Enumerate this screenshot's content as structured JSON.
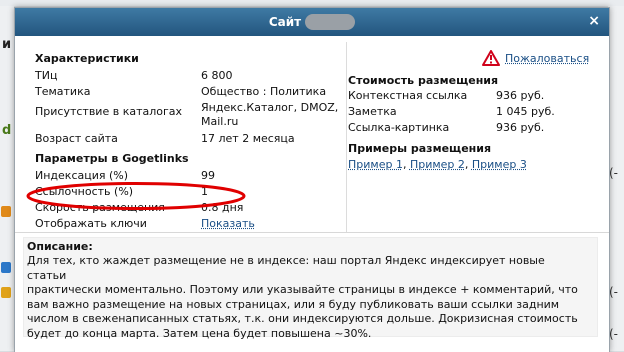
{
  "title": {
    "text": "Сайт"
  },
  "report_link": "Пожаловаться",
  "characteristics": {
    "heading": "Характеристики",
    "rows": [
      {
        "label": "ТИц",
        "value": "6 800"
      },
      {
        "label": "Тематика",
        "value": "Общество : Политика"
      },
      {
        "label": "Присутствие в каталогах",
        "value_lines": [
          "Яндекс.Каталог, DMOZ,",
          "Mail.ru"
        ]
      },
      {
        "label": "Возраст сайта",
        "value": "17 лет 2 месяца"
      }
    ]
  },
  "gogetlinks": {
    "heading": "Параметры в Gogetlinks",
    "rows": [
      {
        "label": "Индексация (%)",
        "value": "99"
      },
      {
        "label": "Ссылочность (%)",
        "value": "1"
      },
      {
        "label": "Скорость размещения",
        "value": "0.8 дня"
      },
      {
        "label": "Отображать ключи",
        "value": "Показать"
      }
    ]
  },
  "pricing": {
    "heading": "Стоимость размещения",
    "rows": [
      {
        "label": "Контекстная ссылка",
        "value": "936 руб."
      },
      {
        "label": "Заметка",
        "value": "1 045 руб."
      },
      {
        "label": "Ссылка-картинка",
        "value": "936 руб."
      }
    ]
  },
  "examples": {
    "heading": "Примеры размещения",
    "links": [
      "Пример 1",
      "Пример 2",
      "Пример 3"
    ]
  },
  "description": {
    "heading": "Описание:",
    "lines": [
      "Для тех, кто жаждет размещение не в индексе: наш портал Яндекс индексирует новые статьи",
      "практически моментально. Поэтому или указывайте страницы в индексе + комментарий, что",
      "вам важно размещение на новых страницах, или я буду публиковать ваши ссылки задним",
      "числом в свеженаписанных статьях, т.к. они индексируются дольше. Докризисная стоимость",
      "будет до конца марта. Затем цена будет повышена ~30%."
    ]
  },
  "background": {
    "left_letters": [
      "и",
      "d"
    ],
    "right_glyphs": [
      "(-",
      "(-",
      "(-"
    ]
  },
  "colors": {
    "title_bar": "#2f6790",
    "link": "#1a4f86",
    "highlight": "#e00000",
    "warning": "#d0021b"
  },
  "icons": {
    "warning": "warning-triangle-icon",
    "close": "close-icon"
  }
}
